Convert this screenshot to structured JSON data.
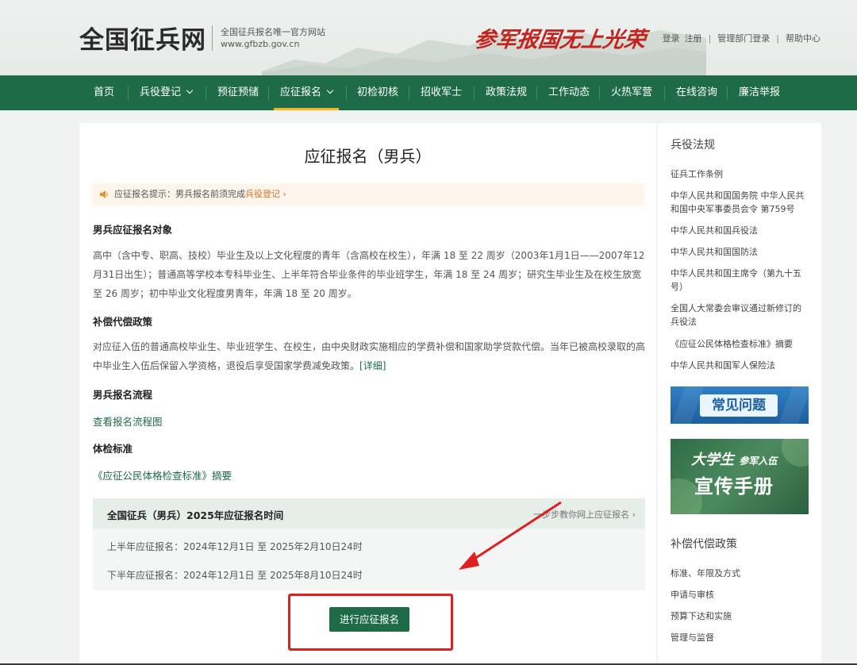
{
  "header": {
    "site_name": "全国征兵网",
    "subtitle": "全国征兵报名唯一官方网站",
    "domain": "www.gfbzb.gov.cn",
    "slogan_left": "参军报国",
    "slogan_right": "无上光荣",
    "top_links": [
      "登录",
      "注册",
      "管理部门登录",
      "帮助中心"
    ]
  },
  "nav": {
    "items": [
      {
        "label": "首页"
      },
      {
        "label": "兵役登记"
      },
      {
        "label": "预征预储"
      },
      {
        "label": "应征报名"
      },
      {
        "label": "初检初核"
      },
      {
        "label": "招收军士"
      },
      {
        "label": "政策法规"
      },
      {
        "label": "工作动态"
      },
      {
        "label": "火热军营"
      },
      {
        "label": "在线咨询"
      },
      {
        "label": "廉洁举报"
      }
    ],
    "active": "应征报名"
  },
  "main": {
    "title": "应征报名（男兵）",
    "notice_prefix": "应征报名提示：男兵报名前须完成",
    "notice_link": "兵役登记 ›",
    "sections": [
      {
        "title": "男兵应征报名对象",
        "text": "高中（含中专、职高、技校）毕业生及以上文化程度的青年（含高校在校生），年满 18 至 22 周岁（2003年1月1日——2007年12月31日出生）；普通高等学校本专科毕业生、上半年符合毕业条件的毕业班学生，年满 18 至 24 周岁；研究生毕业生及在校生放宽至 26 周岁；初中毕业文化程度男青年，年满 18 至 20 周岁。"
      },
      {
        "title": "补偿代偿政策",
        "text": "对应征入伍的普通高校毕业生、毕业班学生、在校生，由中央财政实施相应的学费补偿和国家助学贷款代偿。当年已被高校录取的高中毕业生入伍后保留入学资格，退役后享受国家学费减免政策。",
        "more": "[详细]"
      },
      {
        "title": "男兵报名流程",
        "link": "查看报名流程图"
      },
      {
        "title": "体检标准",
        "link": "《应征公民体格检查标准》摘要"
      }
    ],
    "schedule": {
      "title": "全国征兵（男兵）2025年应征报名时间",
      "guide_link": "一步步教你网上应征报名 ›",
      "rows": [
        "上半年应征报名：2024年12月1日 至 2025年2月10日24时",
        "下半年应征报名：2024年12月1日 至 2025年8月10日24时"
      ]
    },
    "apply_button": "进行应征报名"
  },
  "sidebar": {
    "laws_title": "兵役法规",
    "laws": [
      "征兵工作条例",
      "中华人民共和国国务院 中华人民共和国中央军事委员会令 第759号",
      "中华人民共和国兵役法",
      "中华人民共和国国防法",
      "中华人民共和国主席令（第九十五号）",
      "全国人大常委会审议通过新修订的兵役法",
      "《应征公民体格检查标准》摘要",
      "中华人民共和国军人保险法"
    ],
    "banner_faq": "常见问题",
    "banner_handbook_line1": "大学生",
    "banner_handbook_line1_small": "参军入伍",
    "banner_handbook_line2": "宣传手册",
    "policy_title": "补偿代偿政策",
    "policy_links": [
      "标准、年限及方式",
      "申请与审核",
      "预算下达和实施",
      "管理与监督"
    ]
  },
  "colors": {
    "primary_green": "#1e6b48",
    "nav_active": "#f5b81e",
    "notice_link": "#d8711f",
    "annotation_red": "#e02020",
    "slogan_red": "#c2231f"
  }
}
